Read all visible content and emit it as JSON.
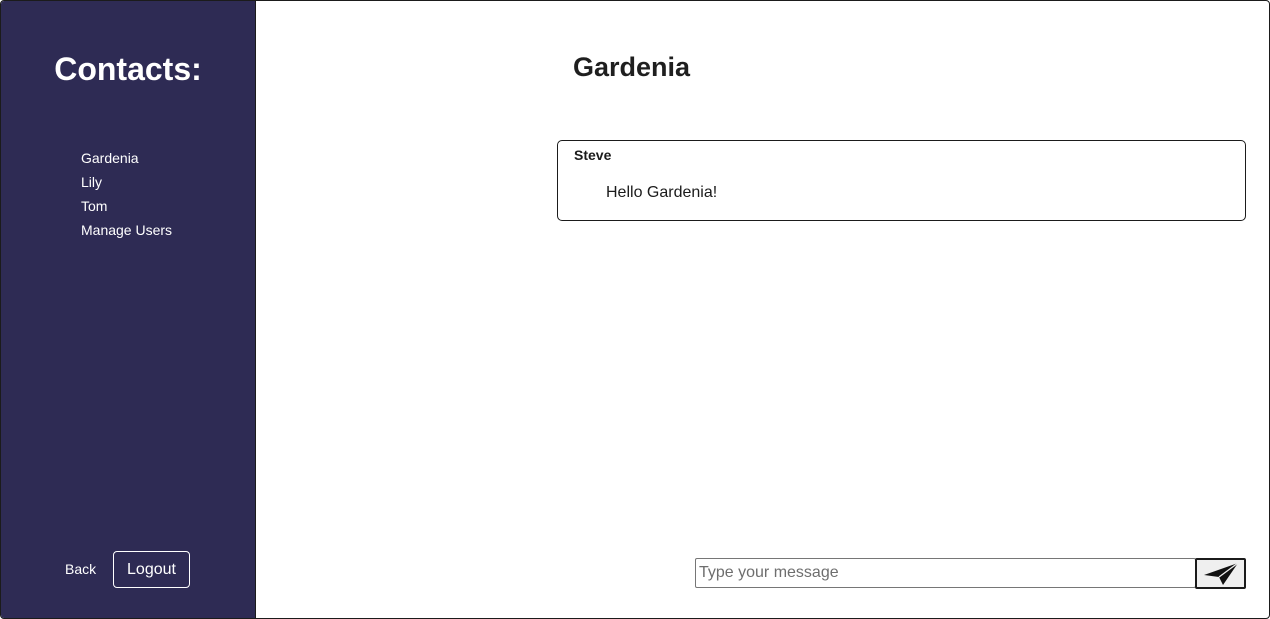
{
  "sidebar": {
    "title": "Contacts:",
    "contacts": [
      "Gardenia",
      "Lily",
      "Tom",
      "Manage Users"
    ],
    "back_label": "Back",
    "logout_label": "Logout",
    "background_color": "#2e2b54"
  },
  "chat": {
    "title": "Gardenia",
    "messages": [
      {
        "sender": "Steve",
        "text": "Hello Gardenia!"
      }
    ],
    "input": {
      "placeholder": "Type your message",
      "value": ""
    },
    "send_icon": "paper-plane-icon"
  }
}
